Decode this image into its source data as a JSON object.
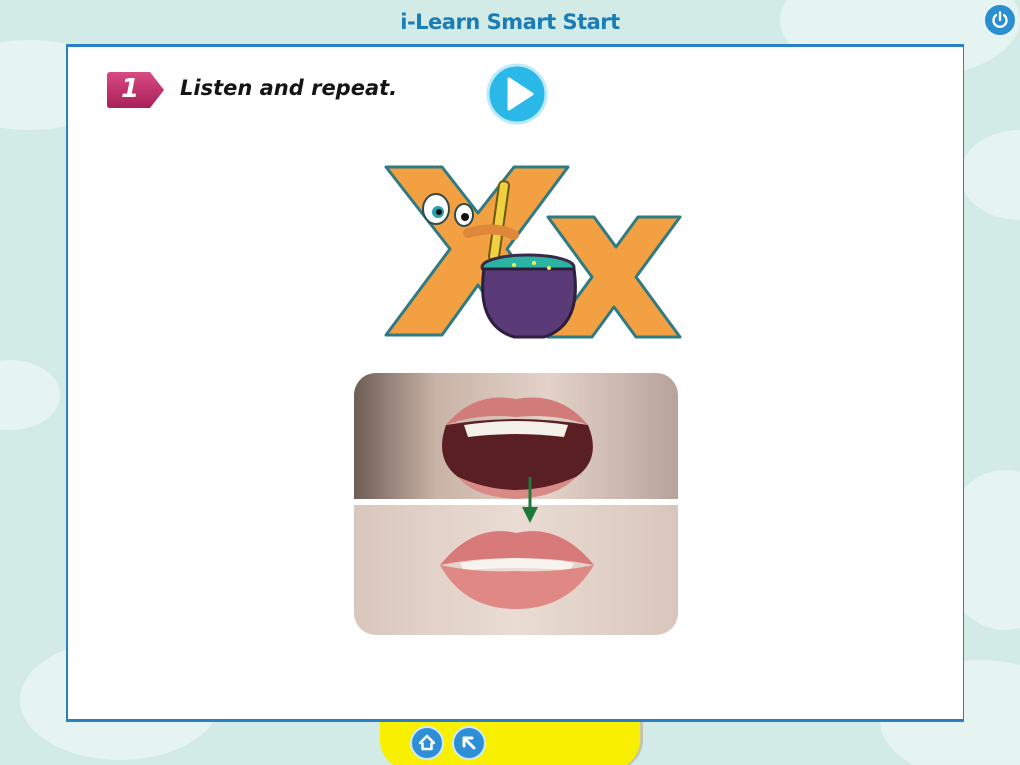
{
  "app": {
    "title": "i-Learn Smart Start"
  },
  "header": {
    "power_icon": "power-icon"
  },
  "exercise": {
    "step_number": "1",
    "instruction": "Listen and repeat.",
    "play_icon": "play-icon"
  },
  "content": {
    "letter_image": "letter-xx-character-with-pot",
    "mouth_image": "mouth-shape-open-to-closed-photo"
  },
  "footer": {
    "home_icon": "home-icon",
    "back_icon": "back-arrow-icon"
  },
  "colors": {
    "background": "#d3ebe7",
    "title": "#1a7db5",
    "page_border": "#2b80c4",
    "step_badge": "#c0306a",
    "play_button": "#29b8e8",
    "bottom_bar": "#f8f000",
    "letter_orange": "#f2a042",
    "pot_purple": "#5b3a78"
  }
}
